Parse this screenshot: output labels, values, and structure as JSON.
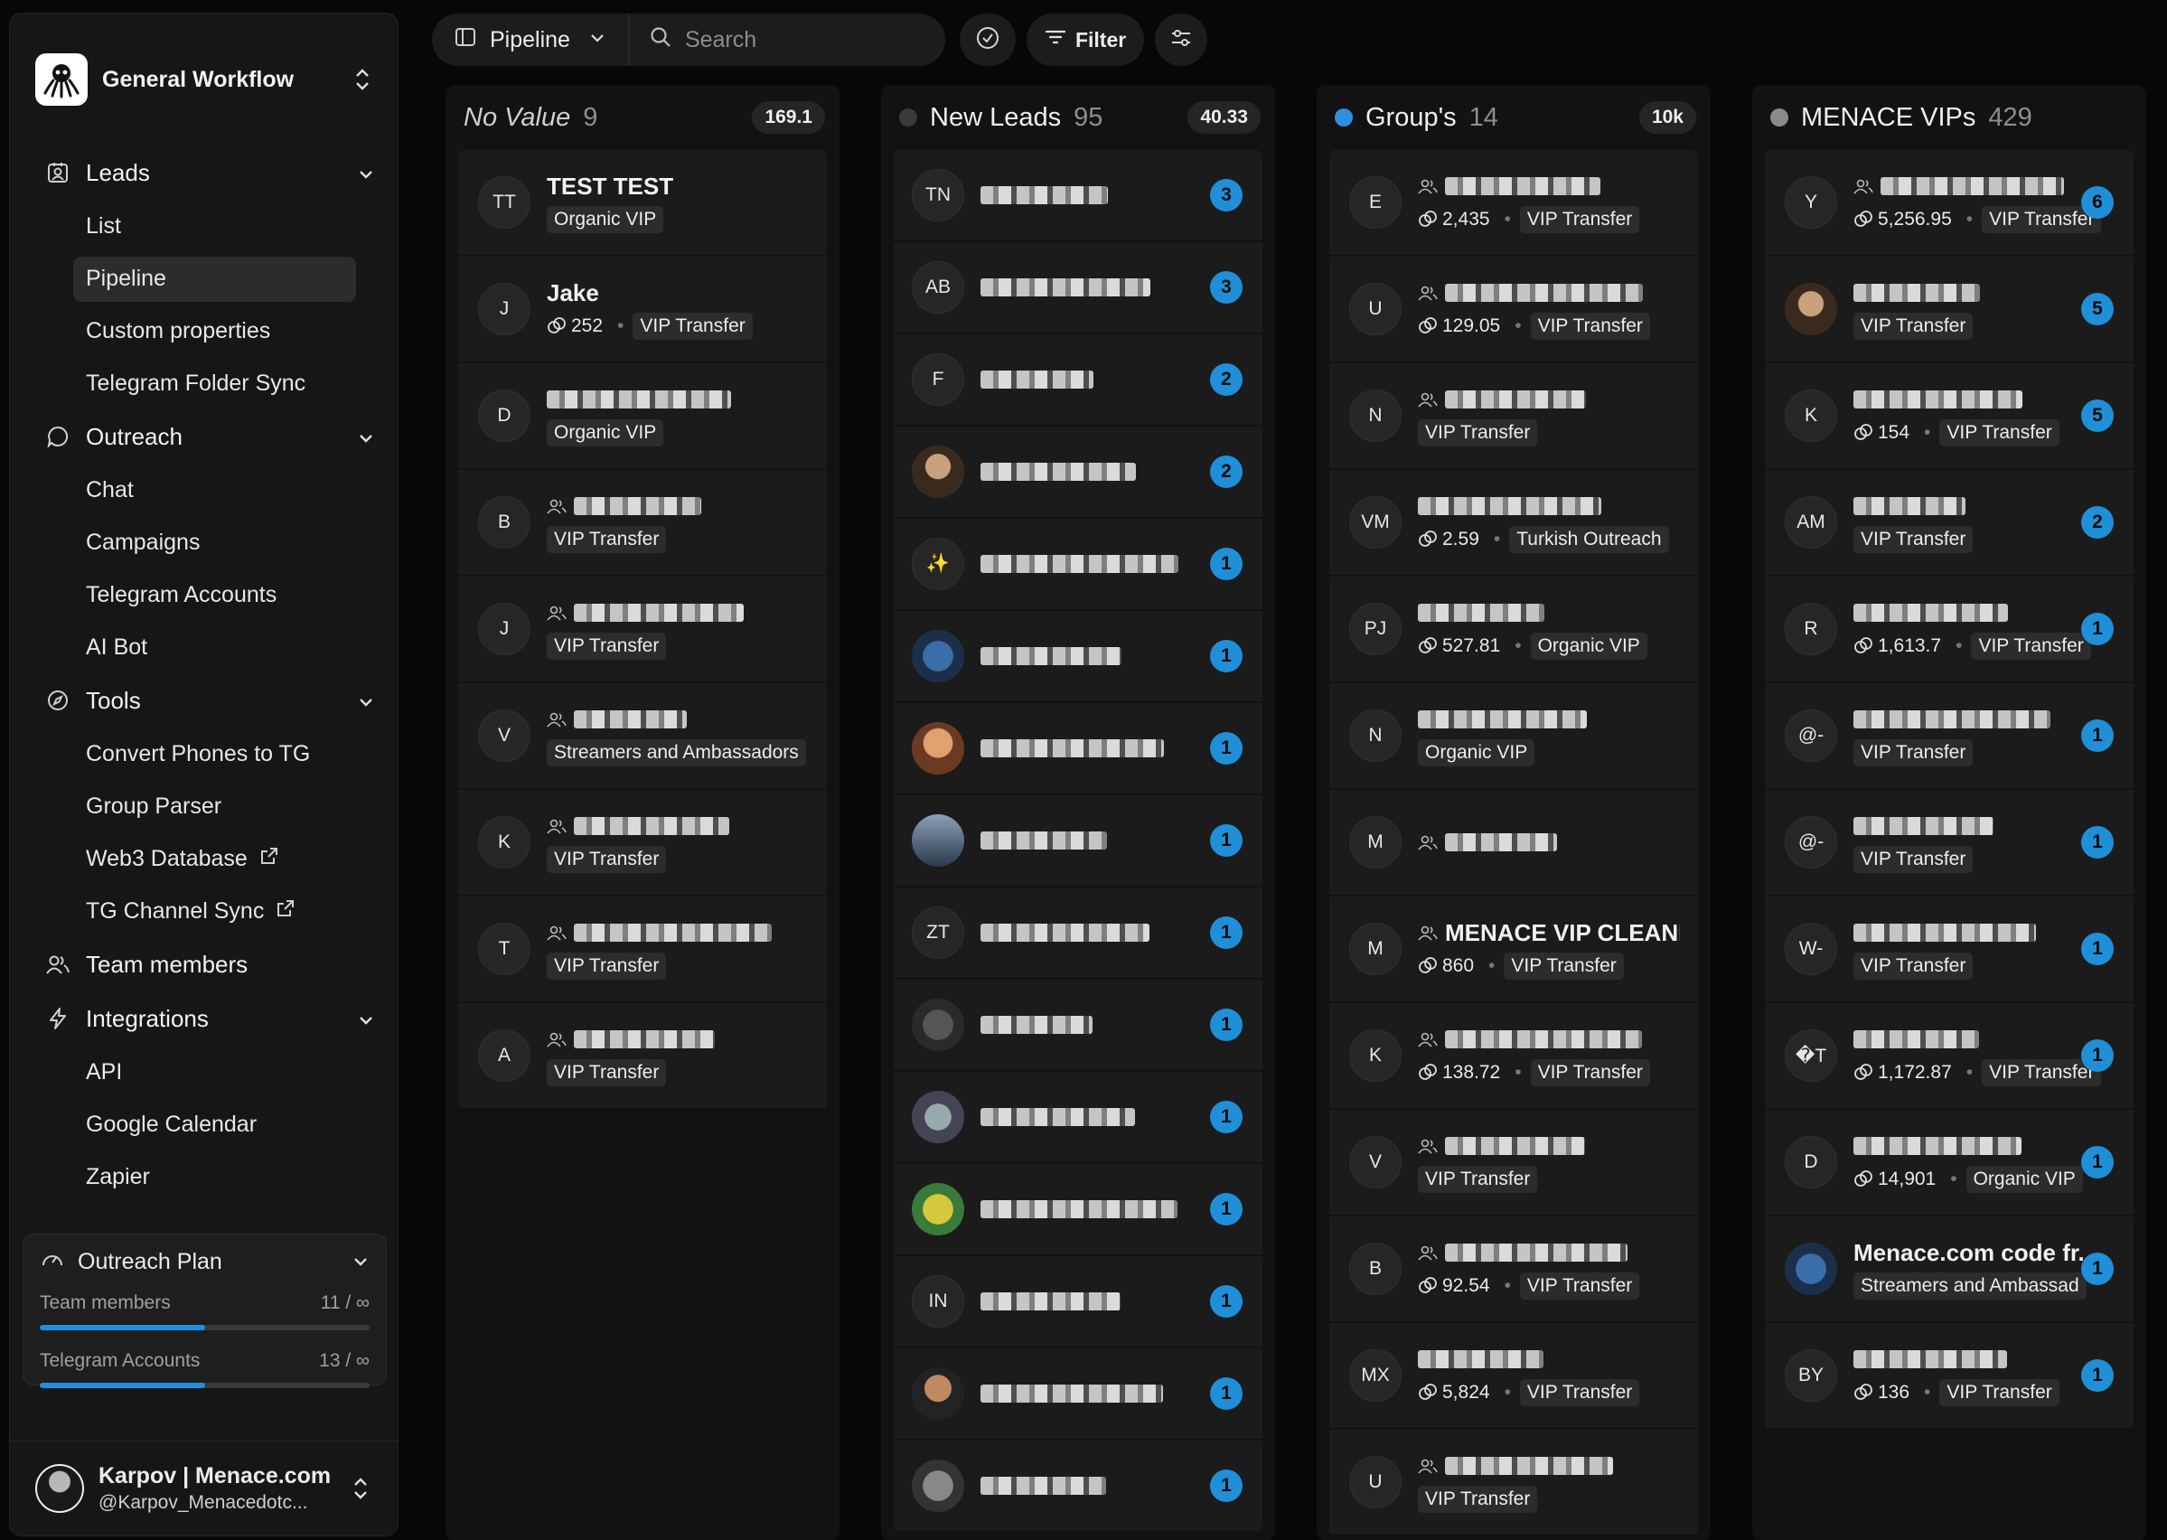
{
  "workspace": {
    "name": "General Workflow"
  },
  "nav": {
    "leads": {
      "label": "Leads",
      "items": [
        "List",
        "Pipeline",
        "Custom properties",
        "Telegram Folder Sync"
      ]
    },
    "outreach": {
      "label": "Outreach",
      "items": [
        "Chat",
        "Campaigns",
        "Telegram Accounts",
        "AI Bot"
      ]
    },
    "tools": {
      "label": "Tools",
      "items": [
        "Convert Phones to TG",
        "Group Parser",
        "Web3 Database",
        "TG Channel Sync"
      ]
    },
    "team": {
      "label": "Team members"
    },
    "integrations": {
      "label": "Integrations",
      "items": [
        "API",
        "Google Calendar",
        "Zapier"
      ]
    }
  },
  "plan": {
    "title": "Outreach Plan",
    "team_label": "Team members",
    "team_value": "11 / ∞",
    "team_fill": 0.5,
    "tg_label": "Telegram Accounts",
    "tg_value": "13 / ∞",
    "tg_fill": 0.5
  },
  "user": {
    "name": "Karpov | Menace.com",
    "handle": "@Karpov_Menacedotc..."
  },
  "toolbar": {
    "view": "Pipeline",
    "search_placeholder": "Search",
    "filter": "Filter"
  },
  "colors": {
    "accent": "#1f8fd8",
    "group_dot": "#2e8fe0",
    "leads_dot": "#3a3a3a",
    "vip_dot": "#8a8a8a"
  },
  "columns": [
    {
      "title": "No Value",
      "count": "9",
      "total": "169.1",
      "cards": [
        {
          "avatar": "TT",
          "name": "TEST TEST",
          "tag": "Organic VIP"
        },
        {
          "avatar": "J",
          "name": "Jake",
          "value": "252",
          "tag": "VIP Transfer"
        },
        {
          "avatar": "D",
          "tag": "Organic VIP"
        },
        {
          "avatar": "B",
          "group": true,
          "tag": "VIP Transfer"
        },
        {
          "avatar": "J",
          "group": true,
          "tag": "VIP Transfer"
        },
        {
          "avatar": "V",
          "group": true,
          "tag": "Streamers and Ambassadors"
        },
        {
          "avatar": "K",
          "group": true,
          "tag": "VIP Transfer"
        },
        {
          "avatar": "T",
          "group": true,
          "tag": "VIP Transfer"
        },
        {
          "avatar": "A",
          "group": true,
          "tag": "VIP Transfer"
        }
      ]
    },
    {
      "title": "New Leads",
      "count": "95",
      "total": "40.33",
      "cards": [
        {
          "avatar": "TN",
          "badge": "3"
        },
        {
          "avatar": "AB",
          "badge": "3"
        },
        {
          "avatar": "F",
          "badge": "2"
        },
        {
          "avatar": "",
          "badge": "2"
        },
        {
          "avatar": "✨",
          "badge": "1"
        },
        {
          "avatar": "",
          "badge": "1"
        },
        {
          "avatar": "",
          "badge": "1"
        },
        {
          "avatar": "",
          "badge": "1"
        },
        {
          "avatar": "ZT",
          "badge": "1"
        },
        {
          "avatar": "",
          "badge": "1"
        },
        {
          "avatar": "",
          "badge": "1"
        },
        {
          "avatar": "",
          "badge": "1"
        },
        {
          "avatar": "IN",
          "badge": "1"
        },
        {
          "avatar": "",
          "badge": "1"
        },
        {
          "avatar": "",
          "badge": "1"
        }
      ]
    },
    {
      "title": "Group's",
      "count": "14",
      "total": "10k",
      "cards": [
        {
          "avatar": "E",
          "group": true,
          "value": "2,435",
          "tag": "VIP Transfer"
        },
        {
          "avatar": "U",
          "group": true,
          "value": "129.05",
          "tag": "VIP Transfer"
        },
        {
          "avatar": "N",
          "group": true,
          "tag": "VIP Transfer"
        },
        {
          "avatar": "VM",
          "value": "2.59",
          "tag": "Turkish Outreach"
        },
        {
          "avatar": "PJ",
          "value": "527.81",
          "tag": "Organic VIP"
        },
        {
          "avatar": "N",
          "tag": "Organic VIP"
        },
        {
          "avatar": "M",
          "group": true
        },
        {
          "avatar": "M",
          "group": true,
          "name": "MENACE VIP CLEANED",
          "value": "860",
          "tag": "VIP Transfer"
        },
        {
          "avatar": "K",
          "group": true,
          "value": "138.72",
          "tag": "VIP Transfer"
        },
        {
          "avatar": "V",
          "group": true,
          "tag": "VIP Transfer"
        },
        {
          "avatar": "B",
          "group": true,
          "value": "92.54",
          "tag": "VIP Transfer"
        },
        {
          "avatar": "MX",
          "value": "5,824",
          "tag": "VIP Transfer"
        },
        {
          "avatar": "U",
          "group": true,
          "tag": "VIP Transfer"
        }
      ]
    },
    {
      "title": "MENACE VIPs",
      "count": "429",
      "total": "",
      "cards": [
        {
          "avatar": "Y",
          "group": true,
          "value": "5,256.95",
          "tag": "VIP Transfer",
          "badge": "6"
        },
        {
          "avatar": "",
          "tag": "VIP Transfer",
          "badge": "5"
        },
        {
          "avatar": "K",
          "value": "154",
          "tag": "VIP Transfer",
          "badge": "5"
        },
        {
          "avatar": "AM",
          "tag": "VIP Transfer",
          "badge": "2"
        },
        {
          "avatar": "R",
          "value": "1,613.7",
          "tag": "VIP Transfer",
          "badge": "1"
        },
        {
          "avatar": "@-",
          "tag": "VIP Transfer",
          "badge": "1"
        },
        {
          "avatar": "@-",
          "tag": "VIP Transfer",
          "badge": "1"
        },
        {
          "avatar": "W-",
          "tag": "VIP Transfer",
          "badge": "1"
        },
        {
          "avatar": "�T",
          "value": "1,172.87",
          "tag": "VIP Transfer",
          "badge": "1"
        },
        {
          "avatar": "D",
          "value": "14,901",
          "tag": "Organic VIP",
          "badge": "1"
        },
        {
          "avatar": "",
          "name": "Menace.com code fr...",
          "tag": "Streamers and Ambassad",
          "badge": "1"
        },
        {
          "avatar": "BY",
          "value": "136",
          "tag": "VIP Transfer",
          "badge": "1"
        }
      ]
    }
  ]
}
